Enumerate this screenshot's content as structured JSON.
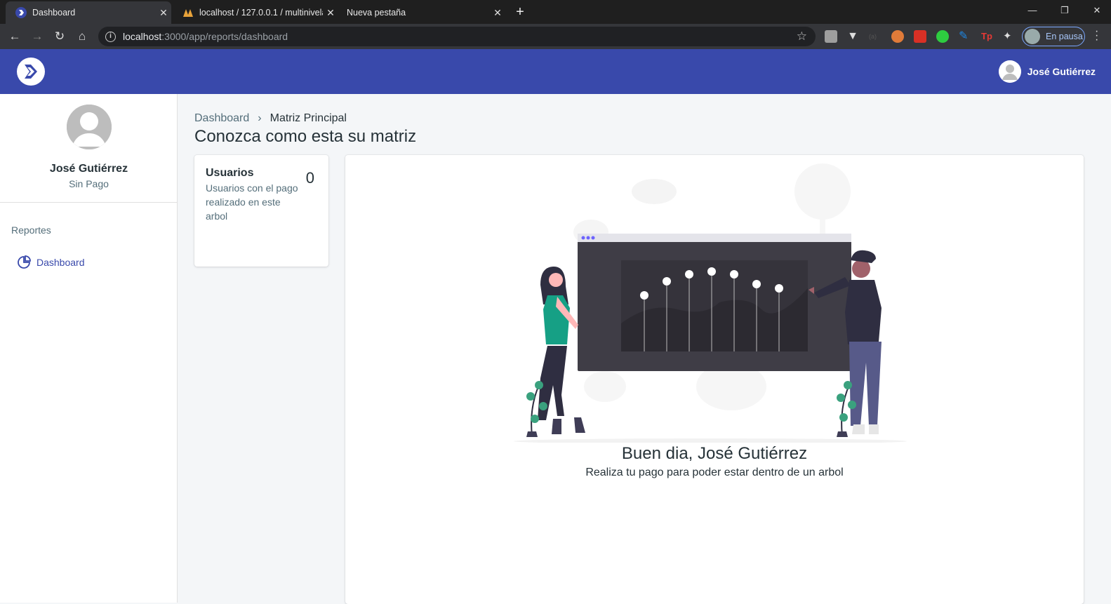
{
  "browser": {
    "tabs": [
      {
        "title": "Dashboard",
        "active": true
      },
      {
        "title": "localhost / 127.0.0.1 / multinivela",
        "active": false
      },
      {
        "title": "Nueva pestaña",
        "active": false
      }
    ],
    "url_host": "localhost",
    "url_path": ":3000/app/reports/dashboard",
    "profile_label": "En pausa"
  },
  "topbar": {
    "user_name": "José Gutiérrez"
  },
  "sidebar": {
    "user_name": "José Gutiérrez",
    "plan": "Sin Pago",
    "section": "Reportes",
    "items": [
      {
        "label": "Dashboard"
      }
    ]
  },
  "breadcrumb": {
    "root": "Dashboard",
    "current": "Matriz Principal"
  },
  "page": {
    "title": "Conozca como esta su matriz"
  },
  "stat_card": {
    "title": "Usuarios",
    "description": "Usuarios con el pago realizado en este arbol",
    "value": "0"
  },
  "main": {
    "greeting": "Buen dia, José Gutiérrez",
    "message": "Realiza tu pago para poder estar dentro de un arbol"
  },
  "colors": {
    "primary": "#3949ab",
    "accent": "#3949ab"
  }
}
